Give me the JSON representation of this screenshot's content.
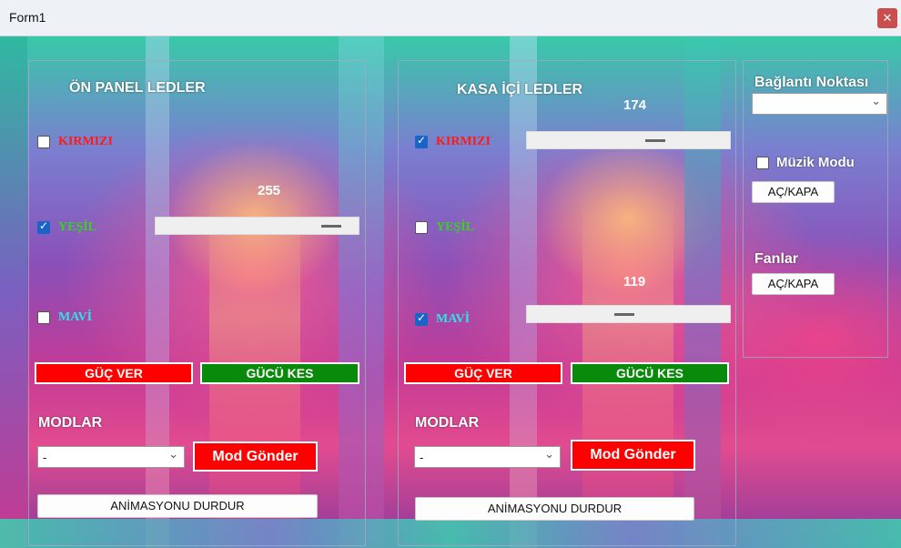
{
  "window": {
    "title": "Form1",
    "close_glyph": "✕"
  },
  "front_panel": {
    "heading": "ÖN PANEL LEDLER",
    "red": {
      "label": "KIRMIZI",
      "checked": false
    },
    "green": {
      "label": "YEŞİL",
      "checked": true,
      "value": "255"
    },
    "blue": {
      "label": "MAVİ",
      "checked": false
    },
    "power_on": "GÜÇ VER",
    "power_off": "GÜCÜ KES",
    "modes_heading": "MODLAR",
    "mode_select": "-",
    "send_mode": "Mod Gönder",
    "stop_animation": "ANİMASYONU DURDUR"
  },
  "case_panel": {
    "heading": "KASA İÇİ LEDLER",
    "red": {
      "label": "KIRMIZI",
      "checked": true,
      "value": "174"
    },
    "green": {
      "label": "YEŞİL",
      "checked": false
    },
    "blue": {
      "label": "MAVİ",
      "checked": true,
      "value": "119"
    },
    "power_on": "GÜÇ VER",
    "power_off": "GÜCÜ KES",
    "modes_heading": "MODLAR",
    "mode_select": "-",
    "send_mode": "Mod Gönder",
    "stop_animation": "ANİMASYONU DURDUR"
  },
  "right_panel": {
    "connection_heading": "Bağlantı Noktası",
    "port_select": "",
    "music_mode": {
      "label": "Müzik Modu",
      "checked": false
    },
    "music_toggle": "AÇ/KAPA",
    "fans_heading": "Fanlar",
    "fans_toggle": "AÇ/KAPA"
  },
  "colors": {
    "red_label": "#ff1a1a",
    "green_label": "#3bd11b",
    "blue_label": "#2ce5e8",
    "power_on_bg": "#ff0000",
    "power_off_bg": "#0a8a0a",
    "checkbox_checked": "#1a63c8"
  },
  "icons": {
    "dropdown": "chevron-down-icon",
    "close": "close-icon",
    "check": "checkmark-icon"
  }
}
